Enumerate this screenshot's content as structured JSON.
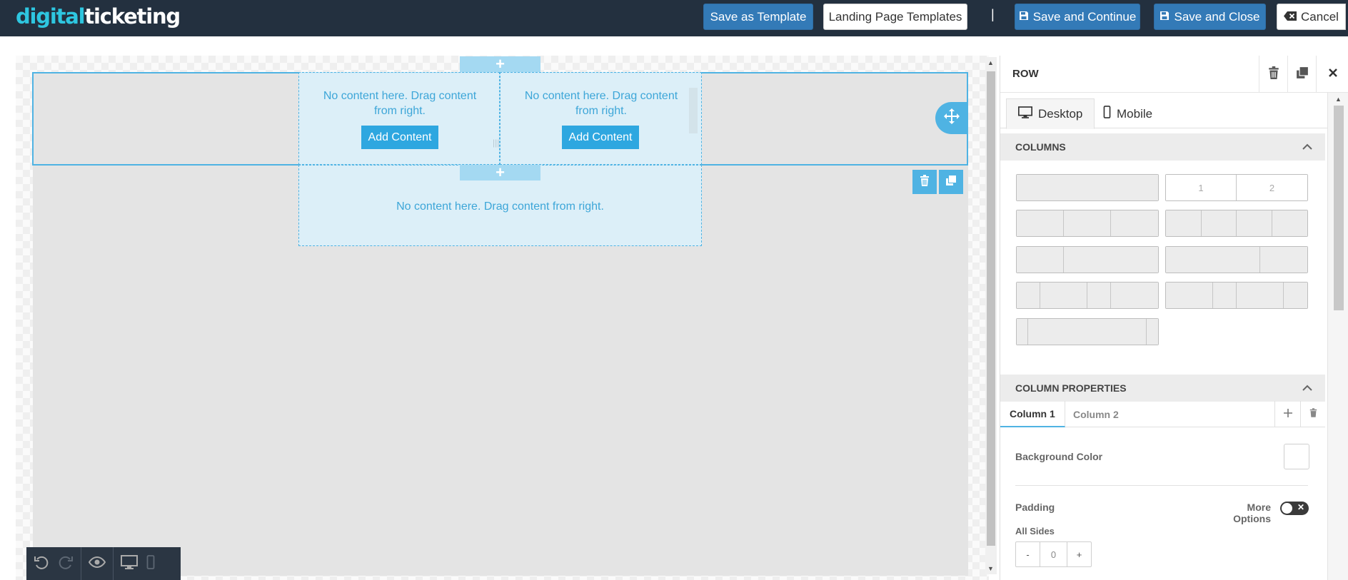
{
  "header": {
    "logo_part1": "digital",
    "logo_part2": "ticketing",
    "save_template": "Save as Template",
    "landing_templates": "Landing Page Templates",
    "separator": "|",
    "save_continue": "Save and Continue",
    "save_close": "Save and Close",
    "cancel": "Cancel"
  },
  "canvas": {
    "plus": "+",
    "col1_msg": "No content here. Drag content from right.",
    "col2_msg": "No content here. Drag content from right.",
    "col3_msg": "No content here. Drag content from right.",
    "add_content": "Add Content",
    "add_content_2": "Add Content",
    "divider": "|||"
  },
  "panel": {
    "title": "ROW",
    "tab_desktop": "Desktop",
    "tab_mobile": "Mobile",
    "columns_header": "COLUMNS",
    "layout_label_1": "1",
    "layout_label_2": "2",
    "column_props_header": "COLUMN PROPERTIES",
    "col_tab_1": "Column 1",
    "col_tab_2": "Column 2",
    "bg_color_label": "Background Color",
    "padding_label": "Padding",
    "more_options": "More Options",
    "all_sides": "All Sides",
    "minus": "-",
    "padding_value": "0",
    "plus": "+"
  },
  "colors": {
    "topbar": "#23303f",
    "primary": "#337ab7",
    "accent": "#2ea7e0",
    "selection": "#4fb3e3",
    "logo_cyan": "#2ec6e0"
  }
}
